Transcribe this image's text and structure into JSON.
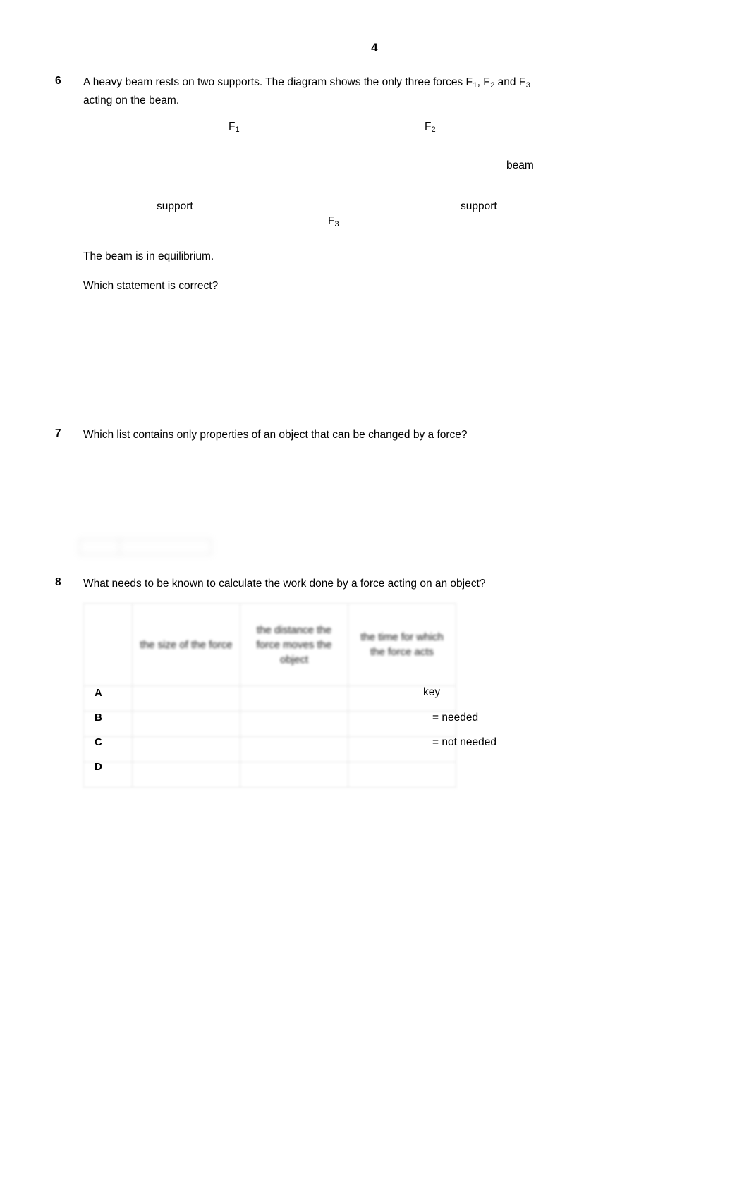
{
  "page": {
    "number": "4"
  },
  "questions": [
    {
      "number": "6",
      "text_part1": "A heavy beam rests on two supports. The diagram shows the only three forces F",
      "sub1": "1",
      "text_part2": ", F",
      "sub2": "2",
      "text_part3": " and F",
      "sub3": "3",
      "text_part4": "acting on the beam.",
      "statement_1": "The beam is in equilibrium.",
      "statement_2": "Which statement is correct?",
      "diagram_labels": [
        {
          "base": "F",
          "sub": "1"
        },
        {
          "base": "F",
          "sub": "2"
        },
        {
          "base": "beam",
          "sub": ""
        },
        {
          "base": "support",
          "sub": ""
        },
        {
          "base": "support",
          "sub": ""
        },
        {
          "base": "F",
          "sub": "3"
        }
      ]
    },
    {
      "number": "7",
      "text": "Which list contains only properties of an object that can be changed by a force?"
    },
    {
      "number": "8",
      "text": "What needs to be known to calculate the work done by a force acting on an object?"
    }
  ],
  "answer_grid": {
    "headers": [
      "",
      "the size of the force",
      "the distance the force moves the object",
      "the time for which the force acts"
    ],
    "row_letters": [
      "A",
      "B",
      "C",
      "D"
    ],
    "rows": [
      [
        "",
        "",
        ""
      ],
      [
        "",
        "",
        ""
      ],
      [
        "",
        "",
        ""
      ],
      [
        "",
        "",
        ""
      ]
    ]
  },
  "key": {
    "title": "key",
    "entries": [
      "= needed",
      "= not needed"
    ]
  }
}
